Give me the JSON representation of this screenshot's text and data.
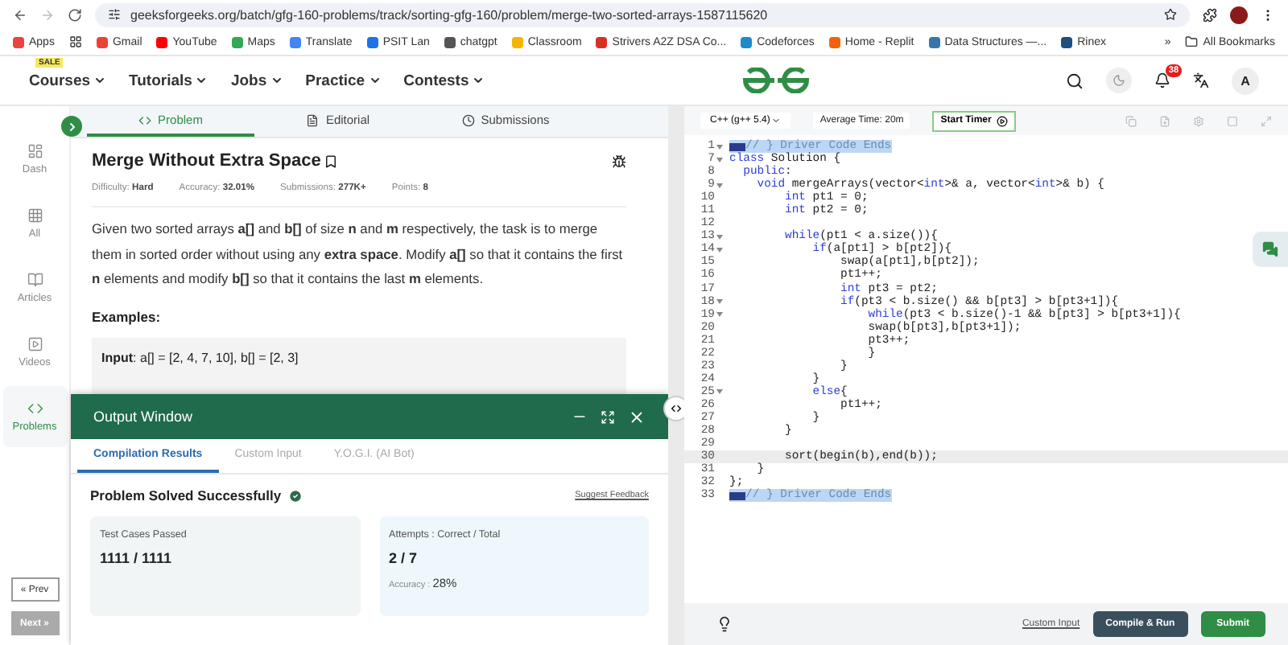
{
  "browser": {
    "url": "geeksforgeeks.org/batch/gfg-160-problems/track/sorting-gfg-160/problem/merge-two-sorted-arrays-1587115620",
    "bookmarks": [
      {
        "label": "Apps",
        "color": "#e8453c"
      },
      {
        "label": "Gmail",
        "color": "#ea4335"
      },
      {
        "label": "YouTube",
        "color": "#ff0000"
      },
      {
        "label": "Maps",
        "color": "#34a853"
      },
      {
        "label": "Translate",
        "color": "#4285f4"
      },
      {
        "label": "PSIT Lan",
        "color": "#1a73e8"
      },
      {
        "label": "chatgpt",
        "color": "#555555"
      },
      {
        "label": "Classroom",
        "color": "#f4b400"
      },
      {
        "label": "Strivers A2Z DSA Co...",
        "color": "#d93025"
      },
      {
        "label": "Codeforces",
        "color": "#1f8acb"
      },
      {
        "label": "Home - Replit",
        "color": "#f26207"
      },
      {
        "label": "Data Structures —...",
        "color": "#3776ab"
      },
      {
        "label": "Rinex",
        "color": "#1c4e80"
      }
    ],
    "overflow": "»",
    "all_bookmarks": "All Bookmarks"
  },
  "nav": {
    "sale_badge": "SALE",
    "menus": [
      "Courses",
      "Tutorials",
      "Jobs",
      "Practice",
      "Contests"
    ],
    "notification_count": "38",
    "avatar": "A"
  },
  "sidebar": {
    "items": [
      {
        "label": "Dash",
        "selected": false
      },
      {
        "label": "All",
        "selected": false
      },
      {
        "label": "Articles",
        "selected": false
      },
      {
        "label": "Videos",
        "selected": false
      },
      {
        "label": "Problems",
        "selected": true
      }
    ],
    "prev": "« Prev",
    "next": "Next »"
  },
  "problem": {
    "tabs": [
      {
        "label": "Problem",
        "selected": true
      },
      {
        "label": "Editorial",
        "selected": false
      },
      {
        "label": "Submissions",
        "selected": false
      }
    ],
    "title": "Merge Without Extra Space",
    "meta": [
      {
        "label": "Difficulty:",
        "value": "Hard"
      },
      {
        "label": "Accuracy:",
        "value": "32.01%"
      },
      {
        "label": "Submissions:",
        "value": "277K+"
      },
      {
        "label": "Points:",
        "value": "8"
      }
    ],
    "description": "Given two sorted arrays **a[]** and **b[]** of size **n** and **m** respectively, the task is to merge them in sorted order without using any **extra space**. Modify **a[]** so that it contains the first **n** elements and modify **b[]** so that it contains the last **m** elements.",
    "examples_heading": "Examples:",
    "example_input": "**Input**: a[] = [2, 4, 7, 10], b[] = [2, 3]"
  },
  "output_window": {
    "title": "Output Window",
    "tabs": [
      {
        "label": "Compilation Results",
        "selected": true
      },
      {
        "label": "Custom Input",
        "selected": false
      },
      {
        "label": "Y.O.G.I. (AI Bot)",
        "selected": false
      }
    ],
    "status": "Problem Solved Successfully",
    "feedback": "Suggest Feedback",
    "tests": {
      "label": "Test Cases Passed",
      "value": "1111 / 1111"
    },
    "attempts": {
      "label": "Attempts : Correct / Total",
      "value": "2 / 7",
      "accuracy_label": "Accuracy :",
      "accuracy": "28%"
    }
  },
  "editor": {
    "language": "C++ (g++ 5.4)",
    "average_time": "Average Time: 20m",
    "timer": "Start Timer",
    "lines": [
      {
        "num": "1",
        "fold": true,
        "marker": true,
        "segments": [
          {
            "kind": "comment",
            "text": "// } Driver Code Ends"
          }
        ]
      },
      {
        "num": "7",
        "fold": true,
        "segments": [
          {
            "kind": "keyword",
            "text": "class"
          },
          {
            "kind": "plain",
            "text": " Solution {"
          }
        ]
      },
      {
        "num": "8",
        "segments": [
          {
            "kind": "keyword",
            "text": "  public"
          },
          {
            "kind": "plain",
            "text": ":"
          }
        ]
      },
      {
        "num": "9",
        "fold": true,
        "segments": [
          {
            "kind": "keyword",
            "text": "    void"
          },
          {
            "kind": "plain",
            "text": " mergeArrays(vector<"
          },
          {
            "kind": "keyword",
            "text": "int"
          },
          {
            "kind": "plain",
            "text": ">& a, vector<"
          },
          {
            "kind": "keyword",
            "text": "int"
          },
          {
            "kind": "plain",
            "text": ">& b) {"
          }
        ]
      },
      {
        "num": "10",
        "segments": [
          {
            "kind": "keyword",
            "text": "        int"
          },
          {
            "kind": "plain",
            "text": " pt1 = 0;"
          }
        ]
      },
      {
        "num": "11",
        "segments": [
          {
            "kind": "keyword",
            "text": "        int"
          },
          {
            "kind": "plain",
            "text": " pt2 = 0;"
          }
        ]
      },
      {
        "num": "12"
      },
      {
        "num": "13",
        "fold": true,
        "segments": [
          {
            "kind": "keyword",
            "text": "        while"
          },
          {
            "kind": "plain",
            "text": "(pt1 < a.size()){"
          }
        ]
      },
      {
        "num": "14",
        "fold": true,
        "segments": [
          {
            "kind": "keyword",
            "text": "            if"
          },
          {
            "kind": "plain",
            "text": "(a[pt1] > b[pt2]){"
          }
        ]
      },
      {
        "num": "15",
        "segments": [
          {
            "kind": "plain",
            "text": "                swap(a[pt1],b[pt2]);"
          }
        ]
      },
      {
        "num": "16",
        "segments": [
          {
            "kind": "plain",
            "text": "                pt1++;"
          }
        ]
      },
      {
        "num": "17",
        "segments": [
          {
            "kind": "keyword",
            "text": "                int"
          },
          {
            "kind": "plain",
            "text": " pt3 = pt2;"
          }
        ]
      },
      {
        "num": "18",
        "fold": true,
        "segments": [
          {
            "kind": "keyword",
            "text": "                if"
          },
          {
            "kind": "plain",
            "text": "(pt3 < b.size() && b[pt3] > b[pt3+1]){"
          }
        ]
      },
      {
        "num": "19",
        "fold": true,
        "segments": [
          {
            "kind": "keyword",
            "text": "                    while"
          },
          {
            "kind": "plain",
            "text": "(pt3 < b.size()-1 && b[pt3] > b[pt3+1]){"
          }
        ]
      },
      {
        "num": "20",
        "segments": [
          {
            "kind": "plain",
            "text": "                    swap(b[pt3],b[pt3+1]);"
          }
        ]
      },
      {
        "num": "21",
        "segments": [
          {
            "kind": "plain",
            "text": "                    pt3++;"
          }
        ]
      },
      {
        "num": "22",
        "segments": [
          {
            "kind": "plain",
            "text": "                    }"
          }
        ]
      },
      {
        "num": "23",
        "segments": [
          {
            "kind": "plain",
            "text": "                }"
          }
        ]
      },
      {
        "num": "24",
        "segments": [
          {
            "kind": "plain",
            "text": "            }"
          }
        ]
      },
      {
        "num": "25",
        "fold": true,
        "segments": [
          {
            "kind": "keyword",
            "text": "            else"
          },
          {
            "kind": "plain",
            "text": "{"
          }
        ]
      },
      {
        "num": "26",
        "segments": [
          {
            "kind": "plain",
            "text": "                pt1++;"
          }
        ]
      },
      {
        "num": "27",
        "segments": [
          {
            "kind": "plain",
            "text": "            }"
          }
        ]
      },
      {
        "num": "28",
        "segments": [
          {
            "kind": "plain",
            "text": "        }"
          }
        ]
      },
      {
        "num": "29"
      },
      {
        "num": "30",
        "active": true,
        "segments": [
          {
            "kind": "plain",
            "text": "        sort(begin(b),end(b));"
          }
        ]
      },
      {
        "num": "31",
        "segments": [
          {
            "kind": "plain",
            "text": "    }"
          }
        ]
      },
      {
        "num": "32",
        "segments": [
          {
            "kind": "plain",
            "text": "};"
          }
        ]
      },
      {
        "num": "33",
        "marker": true,
        "segments": [
          {
            "kind": "comment",
            "text": "// } Driver Code Ends"
          }
        ]
      }
    ],
    "custom_input": "Custom Input",
    "compile": "Compile & Run",
    "submit": "Submit"
  }
}
